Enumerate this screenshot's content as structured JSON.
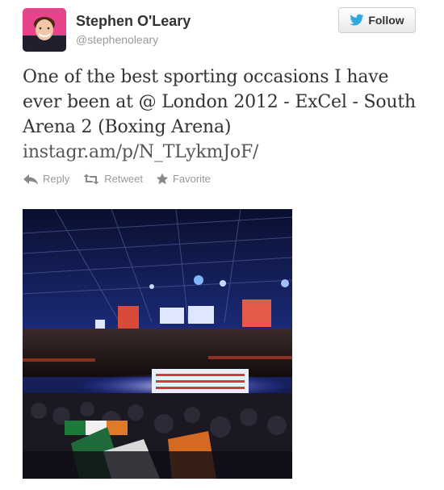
{
  "user": {
    "name": "Stephen O'Leary",
    "handle": "@stephenoleary"
  },
  "follow_button": {
    "label": "Follow"
  },
  "tweet": {
    "lines": [
      "One of the best sporting occasions I have",
      "ever been at @ London 2012 - ExCel - South",
      "Arena 2 (Boxing Arena)"
    ],
    "link": "instagr.am/p/N_TLykmJoF/"
  },
  "actions": {
    "reply": "Reply",
    "retweet": "Retweet",
    "favorite": "Favorite"
  },
  "icons": {
    "follow": "twitter-bird-icon",
    "reply": "reply-arrow-icon",
    "retweet": "retweet-icon",
    "favorite": "star-icon"
  },
  "colors": {
    "text": "#333333",
    "muted": "#999999",
    "bird": "#2fa8e0"
  }
}
